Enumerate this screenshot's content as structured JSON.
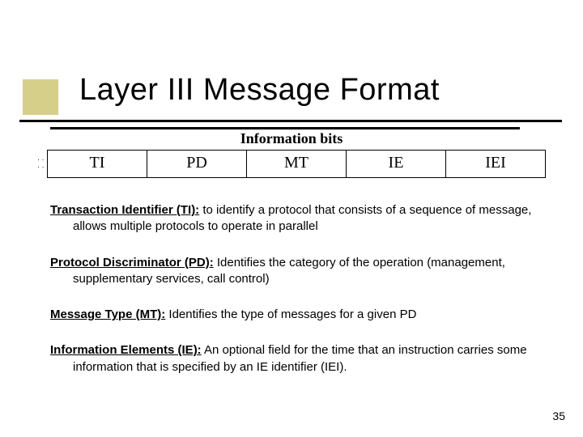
{
  "title": "Layer III Message Format",
  "info_header": "Information bits",
  "fields": [
    "TI",
    "PD",
    "MT",
    "IE",
    "IEI"
  ],
  "definitions": [
    {
      "term": "Transaction Identifier (TI):",
      "body_a": " to identify a protocol that consists of a sequence of message, allows multiple protocols to operate in parallel",
      "body_b": "",
      "body_c": ""
    },
    {
      "term": "Protocol Discriminator (PD):",
      "body_a": "  Identifies the category of the operation (management, supplementary services, call control)",
      "body_b": "",
      "body_c": ""
    },
    {
      "term": "Message Type (MT):",
      "body_a": " Identifies the type of messages for a given PD",
      "body_b": "",
      "body_c": ""
    },
    {
      "term": "Information Elements (IE):",
      "body_a": " An optional field for the time that an instruction carries some information that is specified by an ",
      "body_b": "IE identifier (IEI)",
      "body_c": "."
    }
  ],
  "page_number": "35"
}
